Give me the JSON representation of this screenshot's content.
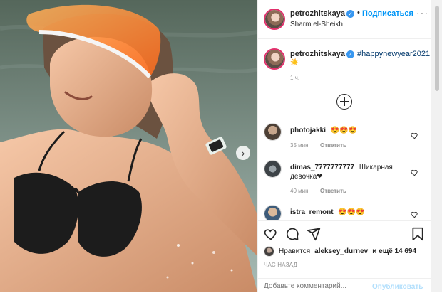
{
  "header": {
    "username": "petrozhitskaya",
    "follow_label": "Подписаться",
    "dot": "•",
    "location": "Sharm el-Sheikh",
    "more": "···"
  },
  "caption": {
    "username": "petrozhitskaya",
    "hashtag": "#happynewyear2021",
    "emoji": "☀️",
    "time": "1 ч."
  },
  "comments": [
    {
      "username": "photojakki",
      "text": "😍😍😍",
      "time": "35 мин.",
      "reply": "Ответить"
    },
    {
      "username": "dimas_7777777777",
      "text": "Шикарная девочка❤",
      "time": "40 мин.",
      "reply": "Ответить"
    },
    {
      "username": "istra_remont",
      "text": "😍😍😍",
      "time": "",
      "reply": ""
    }
  ],
  "actions": {
    "likes_prefix": "Нравится",
    "likes_user": "aleksey_durnev",
    "likes_suffix": "и ещё 14 694",
    "post_time": "ЧАС НАЗАД"
  },
  "comment_box": {
    "placeholder": "Добавьте комментарий...",
    "publish_label": "Опубликовать"
  },
  "icons": [
    "heart-icon",
    "comment-icon",
    "share-icon",
    "bookmark-icon",
    "add-circle-icon",
    "verified-icon",
    "chevron-right-icon"
  ],
  "colors": {
    "accent": "#0095f6",
    "verified": "#3897f0",
    "hashtag": "#00376b",
    "muted": "#8e8e8e"
  }
}
